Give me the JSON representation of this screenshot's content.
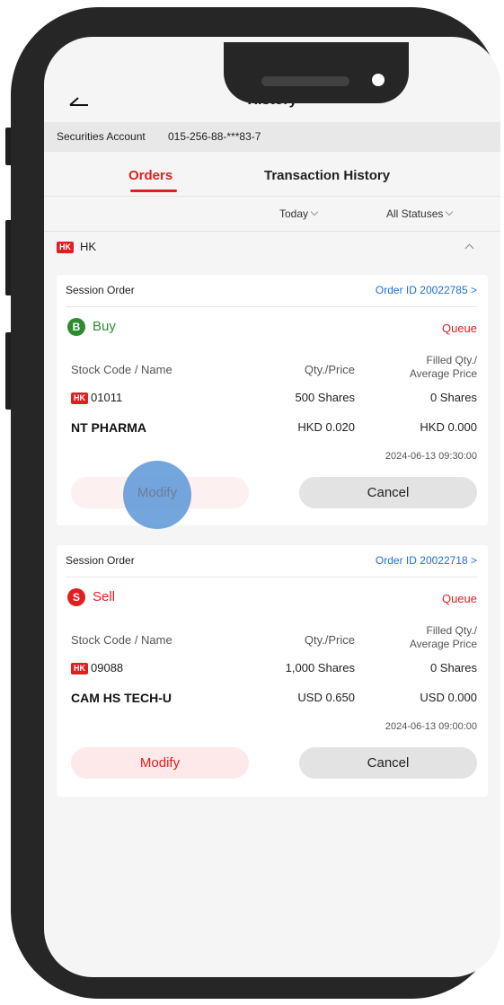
{
  "header": {
    "title": "History"
  },
  "account": {
    "label": "Securities Account",
    "number": "015-256-88-***83-7"
  },
  "tabs": [
    {
      "label": "Orders",
      "active": true
    },
    {
      "label": "Transaction History",
      "active": false
    }
  ],
  "filters": {
    "date": "Today",
    "status": "All Statuses"
  },
  "market": {
    "badge": "HK",
    "label": "HK"
  },
  "columns": {
    "stock": "Stock Code / Name",
    "qty_price": "Qty./Price",
    "filled_line1": "Filled Qty./",
    "filled_line2": "Average Price"
  },
  "orders": [
    {
      "type": "Session Order",
      "order_id": "Order ID 20022785 >",
      "side_icon": "B",
      "side": "Buy",
      "status": "Queue",
      "market_badge": "HK",
      "code": "01011",
      "name": "NT PHARMA",
      "qty": "500 Shares",
      "price": "HKD 0.020",
      "filled_qty": "0 Shares",
      "avg_price": "HKD 0.000",
      "time": "2024-06-13 09:30:00",
      "modify_label": "Modify",
      "cancel_label": "Cancel"
    },
    {
      "type": "Session Order",
      "order_id": "Order ID 20022718 >",
      "side_icon": "S",
      "side": "Sell",
      "status": "Queue",
      "market_badge": "HK",
      "code": "09088",
      "name": "CAM HS TECH-U",
      "qty": "1,000 Shares",
      "price": "USD 0.650",
      "filled_qty": "0 Shares",
      "avg_price": "USD 0.000",
      "time": "2024-06-13 09:00:00",
      "modify_label": "Modify",
      "cancel_label": "Cancel"
    }
  ],
  "colors": {
    "accent": "#e02020",
    "buy": "#2e8b2e",
    "link": "#1e6fd9"
  },
  "icons": {
    "back": "back-arrow-icon",
    "collapse": "chevron-up-icon",
    "dropdown": "chevron-down-icon"
  }
}
